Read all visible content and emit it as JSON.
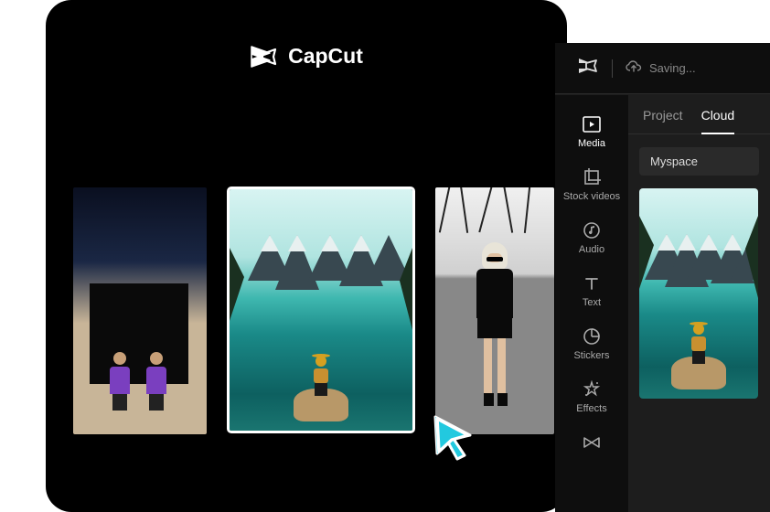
{
  "brand": {
    "name": "CapCut"
  },
  "gallery": {
    "items": [
      {
        "id": "thumb-people-backdrop",
        "selected": false
      },
      {
        "id": "thumb-lake-mountains",
        "selected": true
      },
      {
        "id": "thumb-model-branches",
        "selected": false
      }
    ]
  },
  "editor": {
    "status_label": "Saving...",
    "sidebar": [
      {
        "label": "Media",
        "icon": "media-icon",
        "active": true
      },
      {
        "label": "Stock videos",
        "icon": "crop-icon",
        "active": false
      },
      {
        "label": "Audio",
        "icon": "audio-icon",
        "active": false
      },
      {
        "label": "Text",
        "icon": "text-icon",
        "active": false
      },
      {
        "label": "Stickers",
        "icon": "stickers-icon",
        "active": false
      },
      {
        "label": "Effects",
        "icon": "effects-icon",
        "active": false
      }
    ],
    "tabs": [
      {
        "label": "Project",
        "active": false
      },
      {
        "label": "Cloud",
        "active": true
      }
    ],
    "dropdown": {
      "selected": "Myspace"
    }
  },
  "colors": {
    "accent_cyan": "#22c9df",
    "bg_dark": "#0e0e0e",
    "bg_panel": "#1d1d1d"
  }
}
